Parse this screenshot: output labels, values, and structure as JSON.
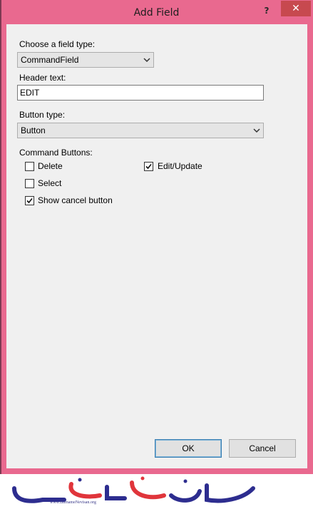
{
  "window": {
    "title": "Add Field",
    "help_glyph": "?",
    "close_glyph": "✕"
  },
  "field_type": {
    "label": "Choose a field type:",
    "value": "CommandField"
  },
  "header_text": {
    "label": "Header text:",
    "value": "EDIT"
  },
  "button_type": {
    "label": "Button type:",
    "value": "Button"
  },
  "command_buttons": {
    "label": "Command Buttons:",
    "items": [
      {
        "label": "Delete",
        "checked": false
      },
      {
        "label": "Edit/Update",
        "checked": true
      },
      {
        "label": "Select",
        "checked": false
      },
      {
        "label": "Show cancel button",
        "checked": true
      }
    ]
  },
  "actions": {
    "ok": "OK",
    "cancel": "Cancel"
  },
  "watermark": {
    "url": "www.BarnameNevisan.org"
  },
  "colors": {
    "frame": "#e9698f",
    "client": "#f0f0f0",
    "logo_blue": "#2d2d8f",
    "logo_red": "#e0353b"
  }
}
